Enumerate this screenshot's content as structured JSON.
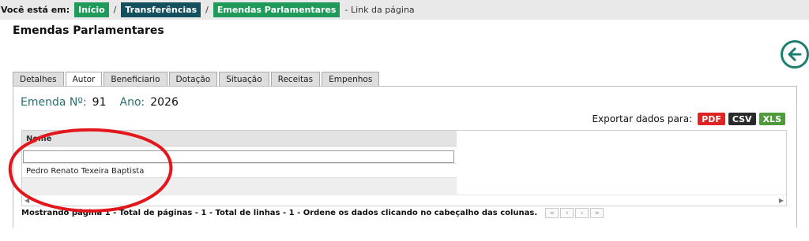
{
  "breadcrumb": {
    "lead": "Você está em:",
    "items": [
      {
        "label": "Início",
        "style": "green"
      },
      {
        "label": "Transferências",
        "style": "teal"
      },
      {
        "label": "Emendas Parlamentares",
        "style": "green"
      }
    ],
    "separator": "/",
    "tail": "- Link da página"
  },
  "page": {
    "title": "Emendas Parlamentares",
    "back_icon": "arrow-left-circle-icon"
  },
  "tabs": [
    {
      "label": "Detalhes",
      "active": false
    },
    {
      "label": "Autor",
      "active": true
    },
    {
      "label": "Beneficiario",
      "active": false
    },
    {
      "label": "Dotação",
      "active": false
    },
    {
      "label": "Situação",
      "active": false
    },
    {
      "label": "Receitas",
      "active": false
    },
    {
      "label": "Empenhos",
      "active": false
    }
  ],
  "emenda": {
    "numero_label": "Emenda Nº:",
    "numero_value": "91",
    "ano_label": "Ano:",
    "ano_value": "2026"
  },
  "export": {
    "label": "Exportar dados para:",
    "formats": [
      "PDF",
      "CSV",
      "XLS"
    ],
    "colors": {
      "pdf": "#e02424",
      "csv": "#2b2b2b",
      "xls": "#4f9a3a"
    }
  },
  "grid": {
    "column_header": "Nome",
    "filter_value": "",
    "rows": [
      "Pedro Renato Texeira Baptista"
    ]
  },
  "footer": {
    "status": "Mostrando página 1 - Total de páginas - 1 - Total de linhas - 1 - Ordene os dados clicando no cabeçalho das colunas.",
    "pager": [
      "«",
      "‹",
      "›",
      "»"
    ]
  },
  "colors": {
    "accent_green": "#1f9a5a",
    "accent_teal": "#134f5c",
    "annotation_red": "#e3161b"
  }
}
